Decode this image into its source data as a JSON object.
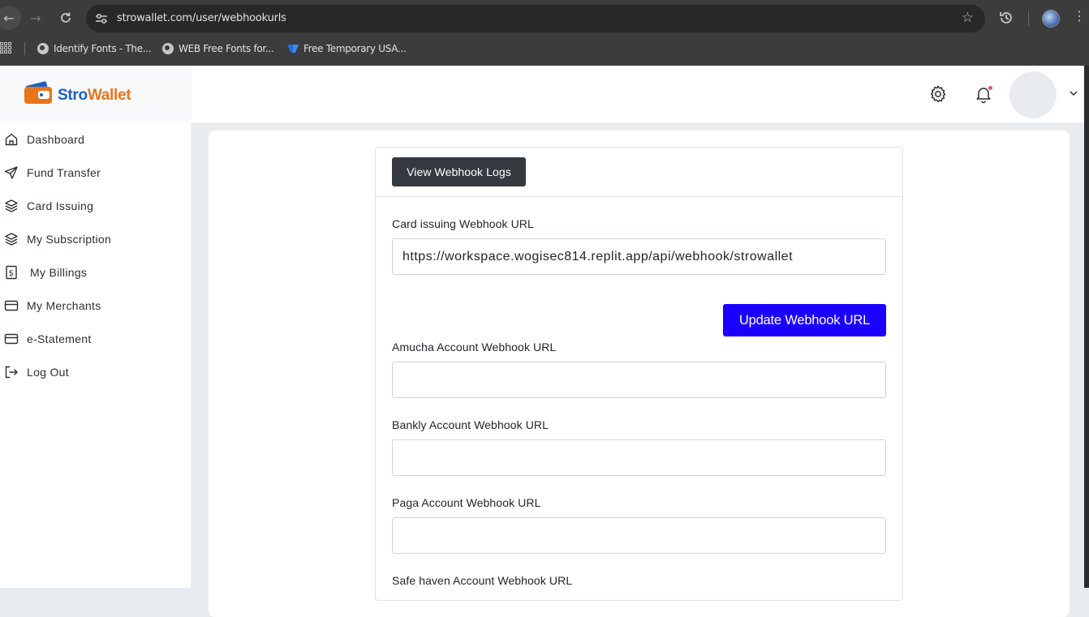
{
  "browser": {
    "url": "strowallet.com/user/webhookurls",
    "bookmarks": [
      {
        "label": "Identify Fonts - The...",
        "icon": "globe-icon"
      },
      {
        "label": "WEB Free Fonts for...",
        "icon": "globe-icon"
      },
      {
        "label": "Free Temporary USA...",
        "icon": "flag-icon"
      }
    ]
  },
  "brand": {
    "name_part1": "Stro",
    "name_part2": "Wallet",
    "colors": {
      "primary": "#1c5fc2",
      "accent": "#e8751a"
    }
  },
  "sidebar": {
    "items": [
      {
        "label": "Dashboard",
        "icon": "home-icon"
      },
      {
        "label": "Fund Transfer",
        "icon": "send-icon"
      },
      {
        "label": "Card Issuing",
        "icon": "layers-icon"
      },
      {
        "label": "My Subscription",
        "icon": "layers-icon"
      },
      {
        "label": "My Billings",
        "icon": "dollar-icon"
      },
      {
        "label": "My Merchants",
        "icon": "card-icon"
      },
      {
        "label": "e-Statement",
        "icon": "card-icon"
      },
      {
        "label": "Log Out",
        "icon": "logout-icon"
      }
    ]
  },
  "form": {
    "logs_button": "View Webhook Logs",
    "update_button": "Update Webhook URL",
    "fields": [
      {
        "label": "Card issuing Webhook URL",
        "value": "https://workspace.wogisec814.replit.app/api/webhook/strowallet"
      },
      {
        "label": "Amucha Account Webhook URL",
        "value": ""
      },
      {
        "label": "Bankly Account Webhook URL",
        "value": ""
      },
      {
        "label": "Paga Account Webhook URL",
        "value": ""
      },
      {
        "label": "Safe haven Account Webhook URL",
        "value": ""
      }
    ]
  },
  "colors": {
    "update_button": "#1a00ff",
    "logs_button": "#343a40",
    "notification_dot": "#e94e77"
  }
}
